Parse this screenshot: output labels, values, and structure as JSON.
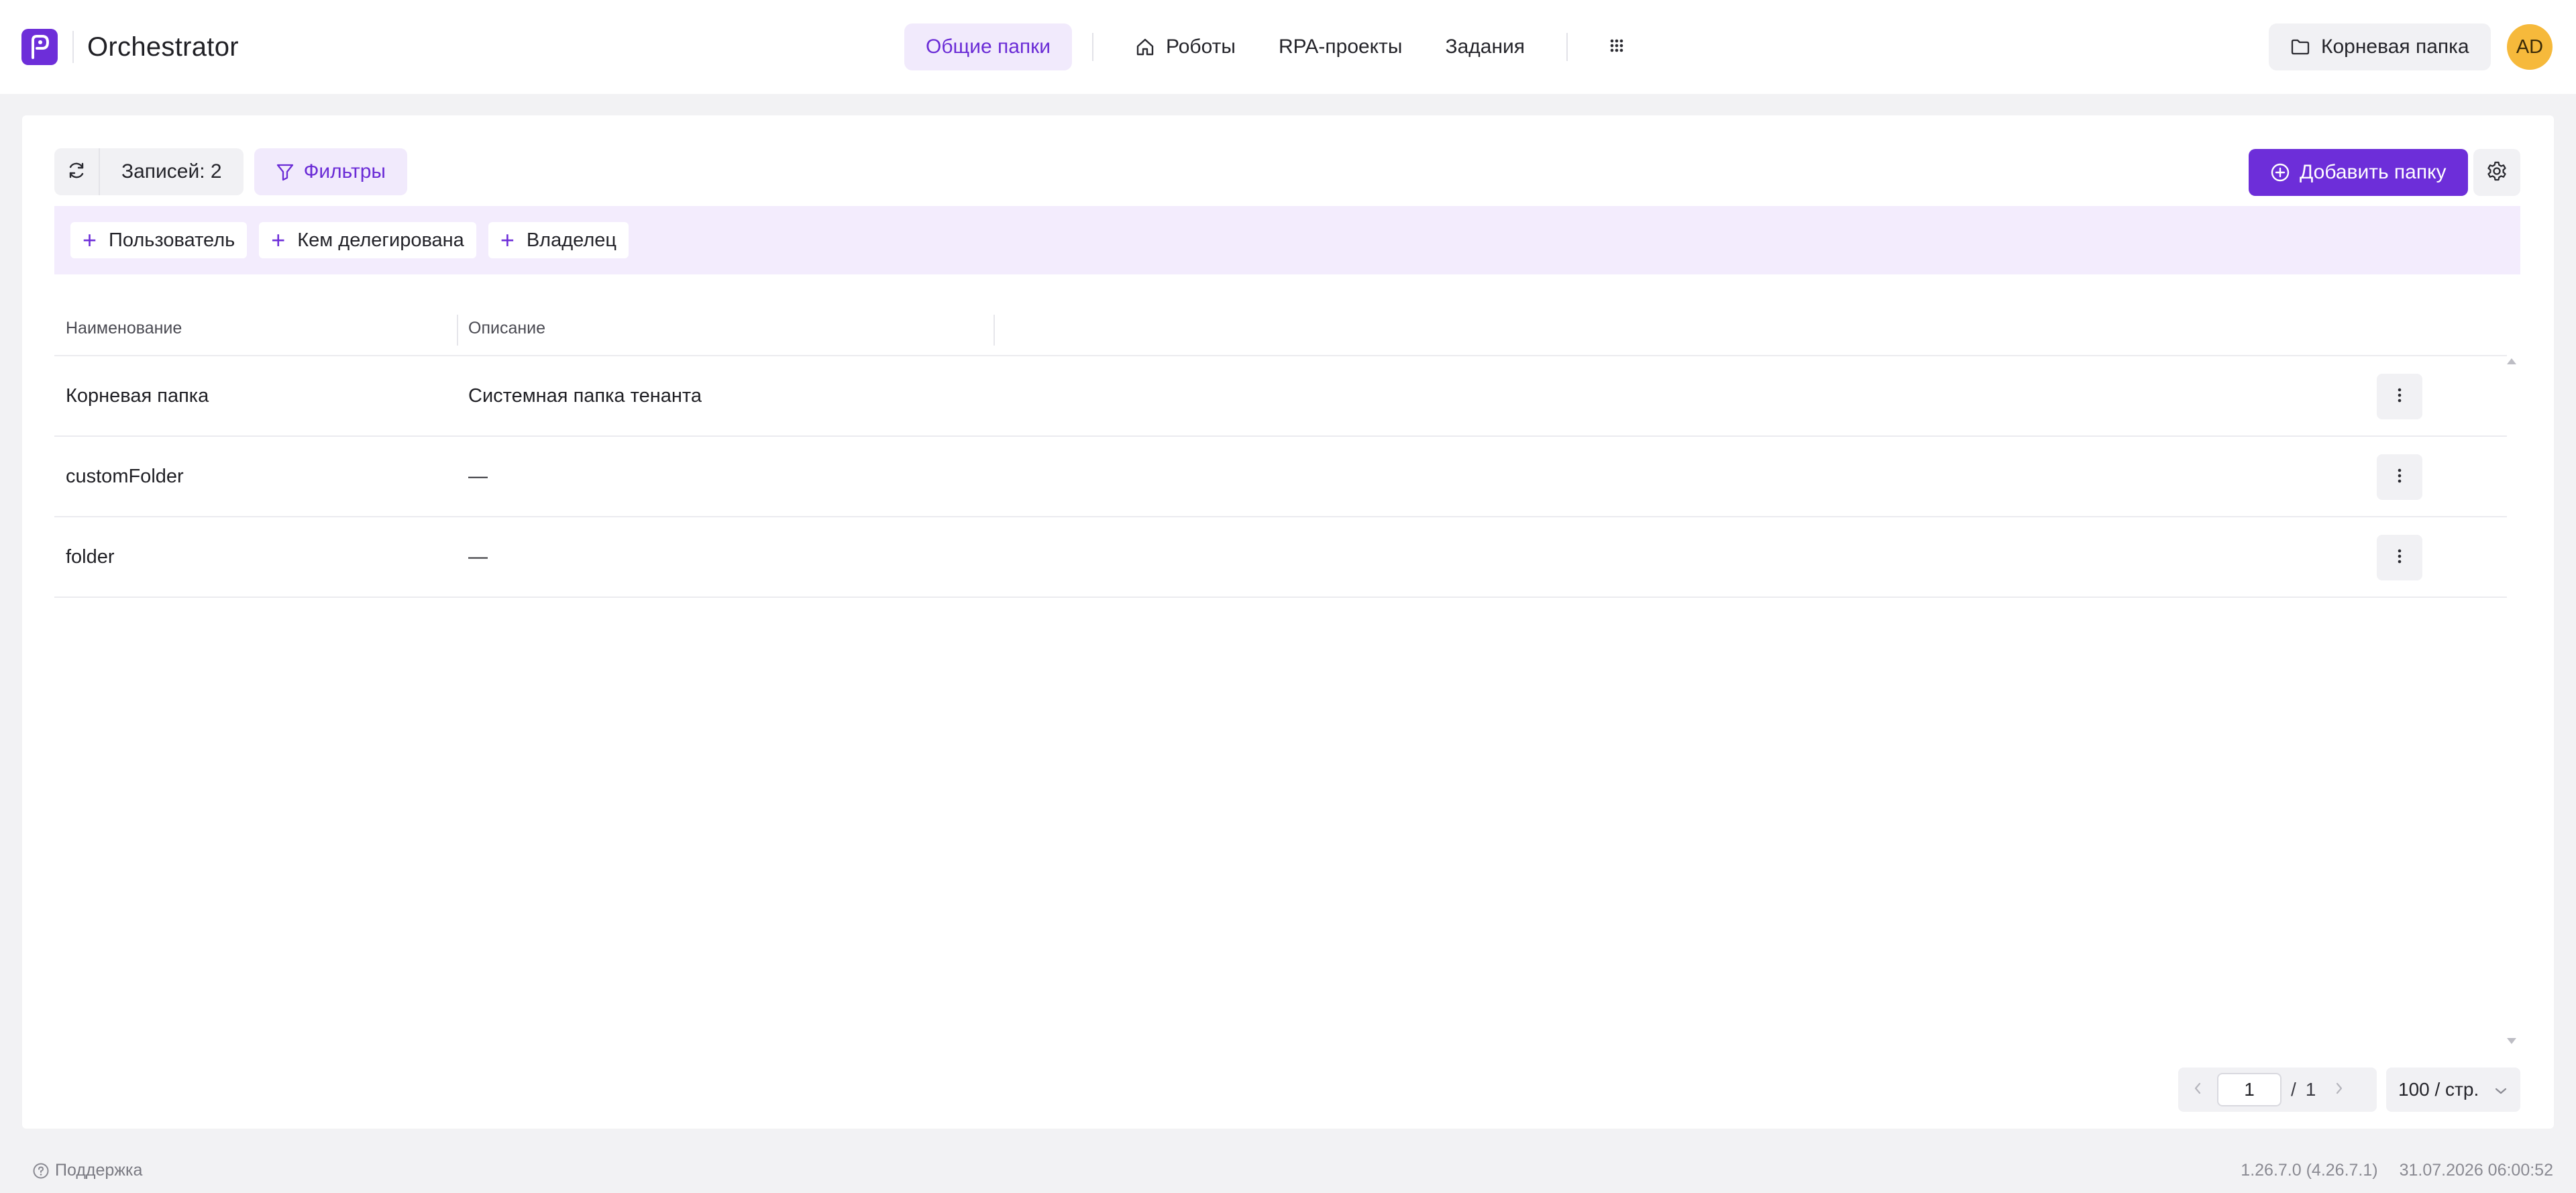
{
  "app": {
    "title": "Orchestrator"
  },
  "nav": {
    "items": [
      {
        "label": "Общие папки",
        "active": true
      },
      {
        "label": "Роботы",
        "icon": "home-icon"
      },
      {
        "label": "RPA-проекты"
      },
      {
        "label": "Задания"
      }
    ],
    "apps_icon": "grid-icon"
  },
  "header": {
    "root_folder_label": "Корневая папка",
    "avatar_initials": "AD"
  },
  "toolbar": {
    "records_label": "Записей: 2",
    "filters_label": "Фильтры",
    "add_folder_label": "Добавить папку"
  },
  "filters": {
    "chips": [
      "Пользователь",
      "Кем делегирована",
      "Владелец"
    ]
  },
  "table": {
    "columns": [
      "Наименование",
      "Описание"
    ],
    "rows": [
      {
        "name": "Корневая папка",
        "description": "Системная папка тенанта"
      },
      {
        "name": "customFolder",
        "description": "—"
      },
      {
        "name": "folder",
        "description": "—"
      }
    ]
  },
  "pagination": {
    "current_page": "1",
    "separator": "/",
    "total_pages": "1",
    "page_size_label": "100 / стр."
  },
  "footer": {
    "support_label": "Поддержка",
    "version": "1.26.7.0 (4.26.7.1)",
    "datetime": "31.07.2026 06:00:52"
  },
  "colors": {
    "accent": "#6d2ed9",
    "accent_light": "#f1eafc",
    "avatar": "#f6b93b"
  }
}
